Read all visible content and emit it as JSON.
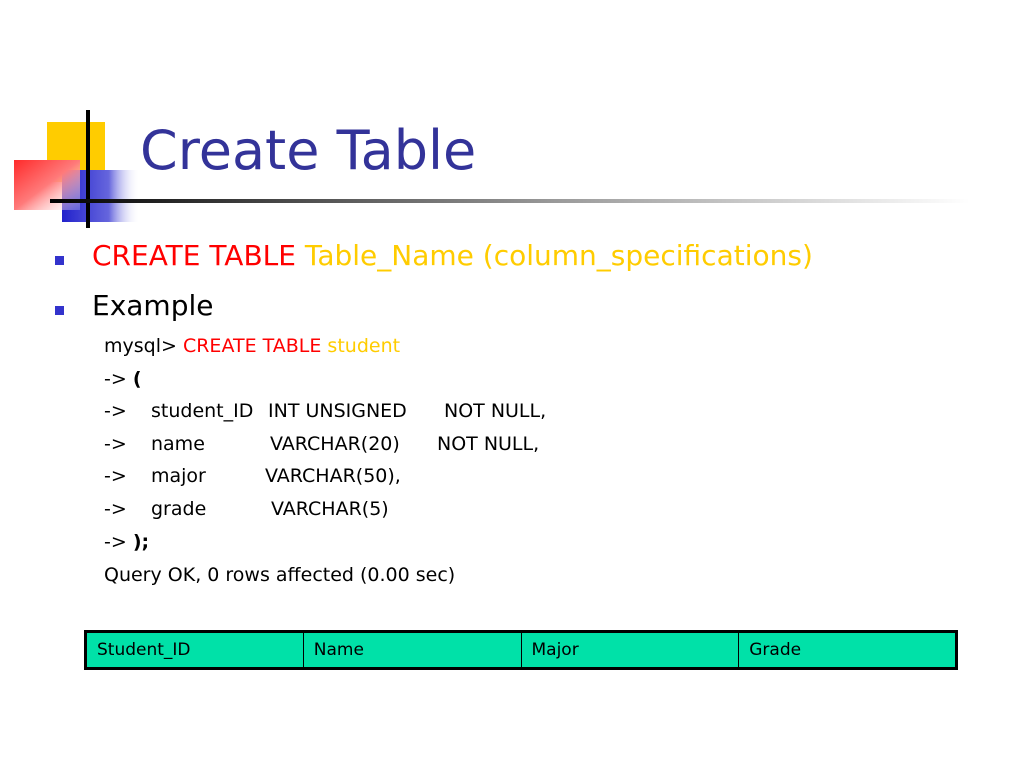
{
  "slide": {
    "title": "Create Table",
    "colors": {
      "title": "#333399",
      "keyword": "#ff0000",
      "identifier": "#ffcc00",
      "bullet": "#3333cc",
      "table_fill": "#00e1a8"
    }
  },
  "bullets": [
    {
      "keyword": "CREATE TABLE",
      "rest": "Table_Name (column_specifications)"
    },
    {
      "text": "Example"
    }
  ],
  "code": {
    "prompt": "mysql>",
    "keyword": "CREATE TABLE",
    "table_name": "student",
    "open_arrow": "->",
    "open_paren": "(",
    "columns": [
      {
        "arrow": "->",
        "name": "student_ID",
        "type": "INT UNSIGNED",
        "constraint": "NOT NULL,"
      },
      {
        "arrow": "->",
        "name": "name",
        "type": "VARCHAR(20)",
        "constraint": "NOT NULL,"
      },
      {
        "arrow": "->",
        "name": "major",
        "type": "VARCHAR(50),",
        "constraint": ""
      },
      {
        "arrow": "->",
        "name": "grade",
        "type": "VARCHAR(5)",
        "constraint": ""
      }
    ],
    "close_arrow": "->",
    "close_paren": ");",
    "result": "Query OK, 0 rows affected (0.00 sec)"
  },
  "table": {
    "headers": [
      "Student_ID",
      "Name",
      "Major",
      "Grade"
    ]
  }
}
